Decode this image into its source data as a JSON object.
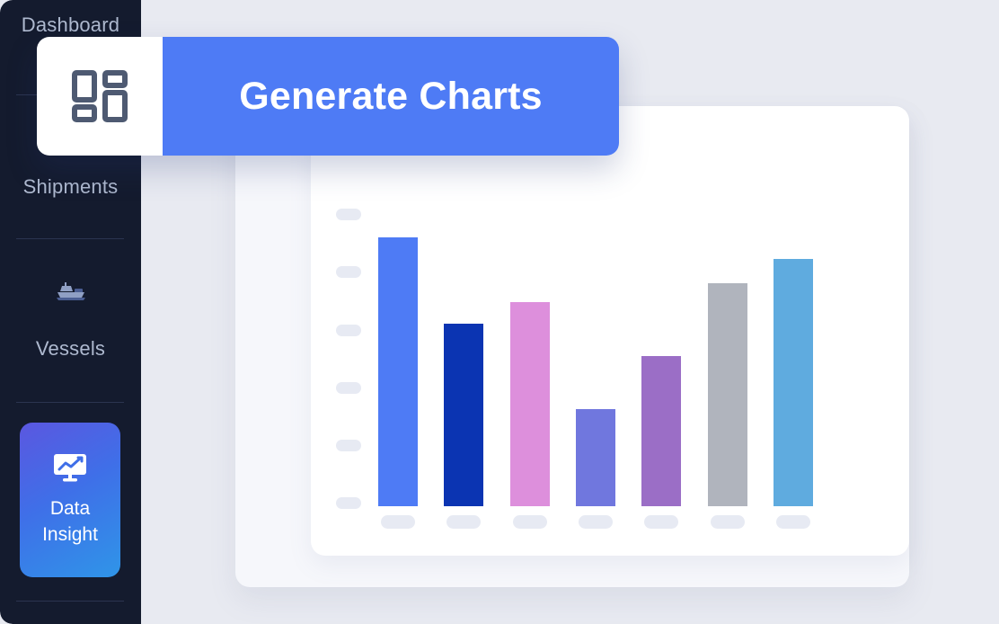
{
  "theme": {
    "page_background": "#e8eaf1",
    "sidebar_background": "#141b2e",
    "sidebar_text": "#aeb9cf",
    "accent_blue": "#4e7bf5",
    "card_outer": "#f6f7fb",
    "card_inner": "#ffffff",
    "placeholder_pill": "#e7eaf3"
  },
  "sidebar": {
    "items": [
      {
        "label": "Dashboard",
        "icon": "dashboard-icon",
        "active": false
      },
      {
        "label": "Shipments",
        "icon": "shipments-icon",
        "active": false
      },
      {
        "label": "Vessels",
        "icon": "ship-icon",
        "active": false
      }
    ],
    "tile": {
      "label_line1": "Data",
      "label_line2": "Insight",
      "icon": "monitor-line-chart-icon",
      "gradient_from": "#5b57e0",
      "gradient_to": "#2f95e8",
      "active": true
    }
  },
  "generate_button": {
    "label": "Generate Charts",
    "icon": "dashboard-grid-icon",
    "icon_color": "#4e5a72",
    "background": "#4e7bf5",
    "text_color": "#ffffff"
  },
  "chart_data": {
    "type": "bar",
    "title": "",
    "subtitle": "",
    "xlabel": "",
    "ylabel": "",
    "grid": false,
    "legend": false,
    "axis_labels_redacted": true,
    "categories": [
      "",
      "",
      "",
      "",
      "",
      "",
      ""
    ],
    "x_tick_placeholders": 7,
    "y_tick_placeholders": 6,
    "ylim": [
      0,
      100
    ],
    "values": [
      100,
      68,
      76,
      36,
      56,
      83,
      92
    ],
    "colors": [
      "#4e7bf5",
      "#0b34b2",
      "#dd8fdc",
      "#7077de",
      "#9b6ec6",
      "#b0b4bd",
      "#5fabdf"
    ],
    "series": [
      {
        "name": "",
        "values": [
          100,
          68,
          76,
          36,
          56,
          83,
          92
        ]
      }
    ]
  }
}
